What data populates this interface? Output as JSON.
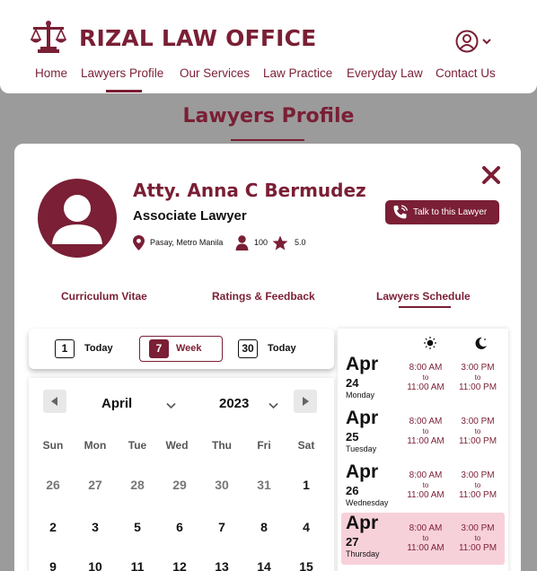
{
  "header": {
    "brand": "RIZAL LAW OFFICE",
    "logo_icon": "scales-of-justice-icon",
    "user_icon": "user-circle-icon",
    "nav": [
      "Home",
      "Lawyers Profile",
      "Our Services",
      "Law Practice",
      "Everyday Law",
      "Contact Us"
    ],
    "active_nav": "Lawyers Profile"
  },
  "page_title": "Lawyers Profile",
  "profile": {
    "name": "Atty. Anna C Bermudez",
    "role": "Associate Lawyer",
    "location": "Pasay, Metro Manila",
    "clients": "100",
    "rating": "5.0",
    "talk_button": "Talk to this Lawyer"
  },
  "tabs": [
    "Curriculum Vitae",
    "Ratings & Feedback",
    "Lawyers Schedule"
  ],
  "active_tab": "Lawyers Schedule",
  "range": [
    {
      "num": "1",
      "label": "Today"
    },
    {
      "num": "7",
      "label": "Week"
    },
    {
      "num": "30",
      "label": "Today"
    }
  ],
  "calendar": {
    "month": "April",
    "year": "2023",
    "weekdays": [
      "Sun",
      "Mon",
      "Tue",
      "Wed",
      "Thu",
      "Fri",
      "Sat"
    ],
    "weeks": [
      [
        "26",
        "27",
        "28",
        "29",
        "30",
        "31",
        "1"
      ],
      [
        "2",
        "3",
        "5",
        "6",
        "7",
        "8",
        "4"
      ],
      [
        "9",
        "10",
        "11",
        "12",
        "13",
        "14",
        "15"
      ]
    ]
  },
  "schedule": {
    "day_icon": "sun-icon",
    "night_icon": "moon-icon",
    "rows": [
      {
        "month": "Apr",
        "day": "24",
        "weekday": "Monday",
        "slot1_from": "8:00 AM",
        "slot1_to": "11:00 AM",
        "slot2_from": "3:00 PM",
        "slot2_to": "11:00 PM",
        "sep": "to"
      },
      {
        "month": "Apr",
        "day": "25",
        "weekday": "Tuesday",
        "slot1_from": "8:00 AM",
        "slot1_to": "11:00 AM",
        "slot2_from": "3:00 PM",
        "slot2_to": "11:00 PM",
        "sep": "to"
      },
      {
        "month": "Apr",
        "day": "26",
        "weekday": "Wednesday",
        "slot1_from": "8:00 AM",
        "slot1_to": "11:00 AM",
        "slot2_from": "3:00 PM",
        "slot2_to": "11:00 PM",
        "sep": "to"
      },
      {
        "month": "Apr",
        "day": "27",
        "weekday": "Thursday",
        "slot1_from": "8:00 AM",
        "slot1_to": "11:00 AM",
        "slot2_from": "3:00 PM",
        "slot2_to": "11:00 PM",
        "sep": "to"
      }
    ]
  },
  "colors": {
    "brand": "#7a1f35",
    "highlight": "#f7d1da",
    "overlay": "#9b9b9b"
  }
}
